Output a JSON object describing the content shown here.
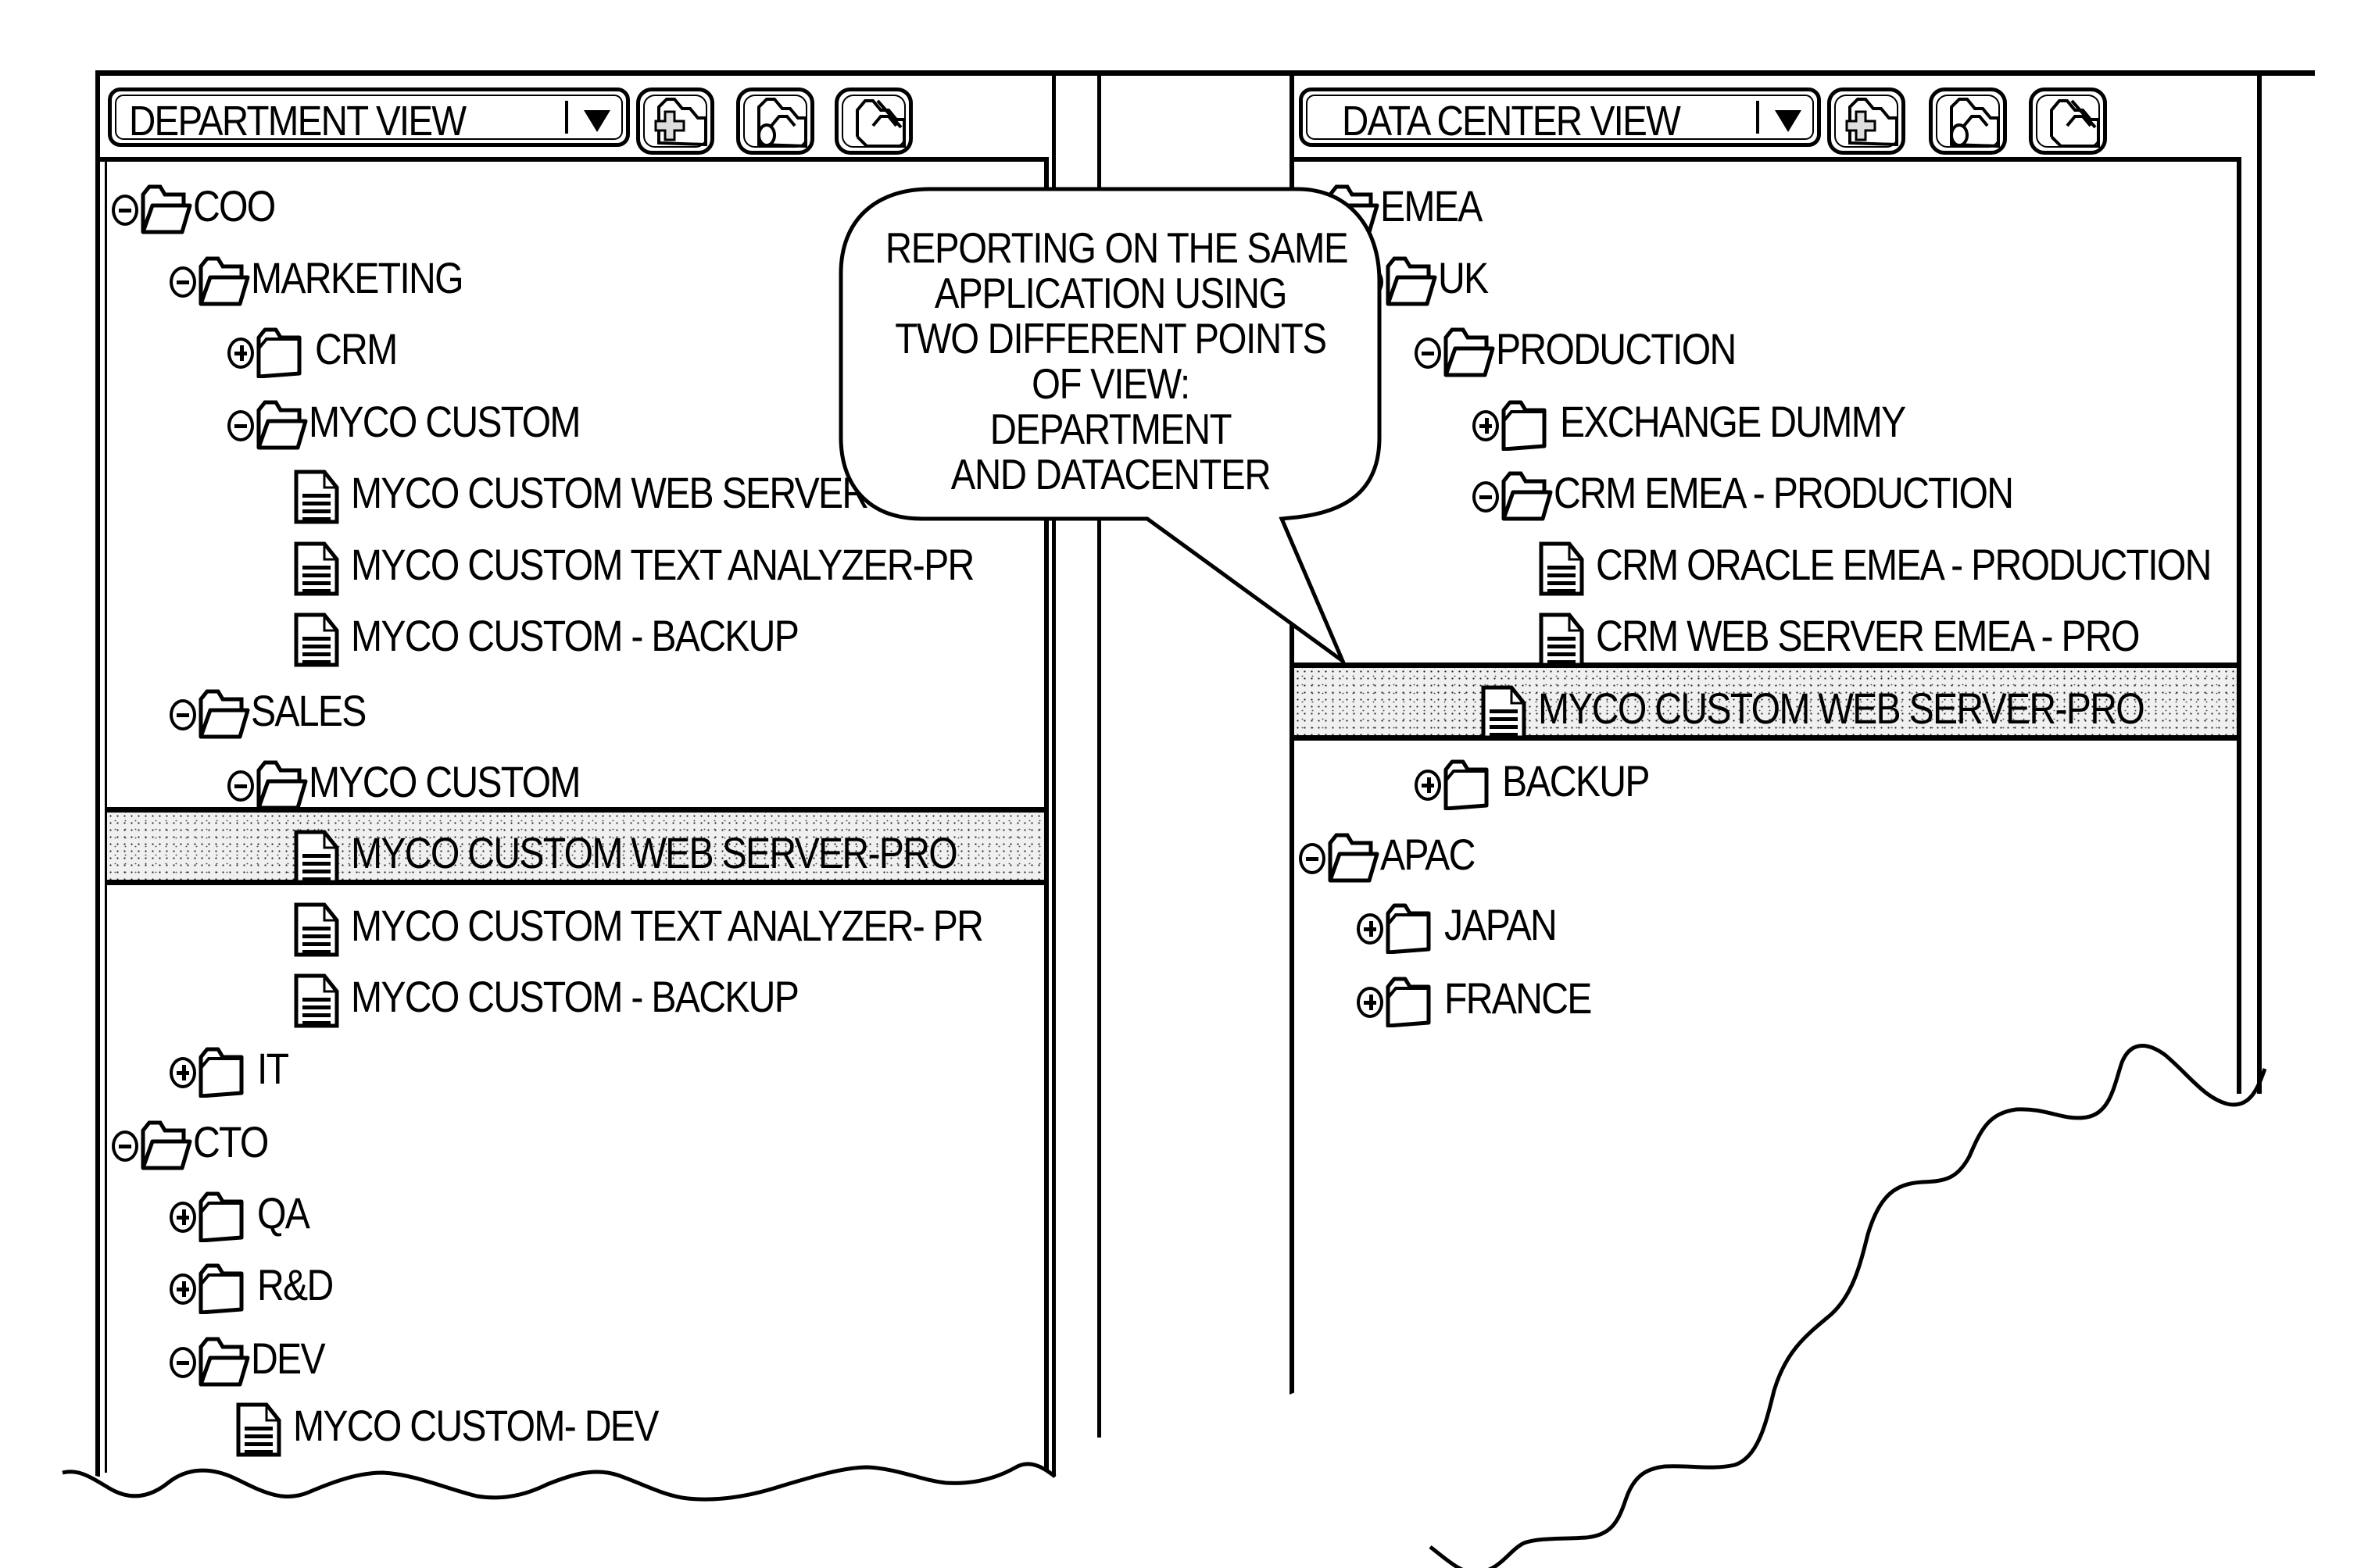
{
  "left_panel": {
    "view_select": {
      "label": "DEPARTMENT VIEW",
      "icon": "dropdown-arrow-icon"
    },
    "toolbar_buttons": [
      {
        "name": "add-folder-button",
        "icon": "folder-add-icon"
      },
      {
        "name": "folder-group-button",
        "icon": "folder-group-icon"
      },
      {
        "name": "folder-remove-button",
        "icon": "folder-remove-icon"
      }
    ],
    "tree": [
      {
        "label": "COO",
        "type": "folder",
        "state": "expanded",
        "level": 0
      },
      {
        "label": "MARKETING",
        "type": "folder",
        "state": "expanded",
        "level": 1
      },
      {
        "label": "CRM",
        "type": "folder",
        "state": "collapsed",
        "level": 2
      },
      {
        "label": "MYCO CUSTOM",
        "type": "folder",
        "state": "expanded",
        "level": 2
      },
      {
        "label": "MYCO CUSTOM WEB SERVER-PRO",
        "type": "document",
        "level": 3
      },
      {
        "label": "MYCO CUSTOM TEXT ANALYZER-PR",
        "type": "document",
        "level": 3
      },
      {
        "label": "MYCO CUSTOM - BACKUP",
        "type": "document",
        "level": 3
      },
      {
        "label": "SALES",
        "type": "folder",
        "state": "expanded",
        "level": 1
      },
      {
        "label": "MYCO CUSTOM",
        "type": "folder",
        "state": "expanded",
        "level": 2
      },
      {
        "label": "MYCO CUSTOM WEB SERVER-PRO",
        "type": "document",
        "level": 3,
        "selected": true
      },
      {
        "label": "MYCO CUSTOM TEXT ANALYZER- PR",
        "type": "document",
        "level": 3
      },
      {
        "label": "MYCO CUSTOM - BACKUP",
        "type": "document",
        "level": 3
      },
      {
        "label": "IT",
        "type": "folder",
        "state": "collapsed",
        "level": 1
      },
      {
        "label": "CTO",
        "type": "folder",
        "state": "expanded",
        "level": 0
      },
      {
        "label": "QA",
        "type": "folder",
        "state": "collapsed",
        "level": 1
      },
      {
        "label": "R&D",
        "type": "folder",
        "state": "collapsed",
        "level": 1
      },
      {
        "label": "DEV",
        "type": "folder",
        "state": "expanded",
        "level": 1
      },
      {
        "label": "MYCO CUSTOM- DEV",
        "type": "document",
        "level": 2
      }
    ]
  },
  "right_panel": {
    "view_select": {
      "label": "DATA CENTER VIEW",
      "icon": "dropdown-arrow-icon"
    },
    "toolbar_buttons": [
      {
        "name": "add-folder-button",
        "icon": "folder-add-icon"
      },
      {
        "name": "folder-group-button",
        "icon": "folder-group-icon"
      },
      {
        "name": "folder-remove-button",
        "icon": "folder-remove-icon"
      }
    ],
    "tree": [
      {
        "label": "EMEA",
        "type": "folder",
        "state": "expanded",
        "level": 0
      },
      {
        "label": "UK",
        "type": "folder",
        "state": "expanded",
        "level": 1
      },
      {
        "label": "PRODUCTION",
        "type": "folder",
        "state": "expanded",
        "level": 2
      },
      {
        "label": "EXCHANGE DUMMY",
        "type": "folder",
        "state": "collapsed",
        "level": 3
      },
      {
        "label": "CRM EMEA - PRODUCTION",
        "type": "folder",
        "state": "expanded",
        "level": 3
      },
      {
        "label": "CRM ORACLE EMEA - PRODUCTION",
        "type": "document",
        "level": 4
      },
      {
        "label": "CRM WEB SERVER EMEA - PRO",
        "type": "document",
        "level": 4
      },
      {
        "label": "MYCO CUSTOM WEB SERVER-PRO",
        "type": "document",
        "level": 3,
        "selected": true
      },
      {
        "label": "BACKUP",
        "type": "folder",
        "state": "collapsed",
        "level": 2
      },
      {
        "label": "APAC",
        "type": "folder",
        "state": "expanded",
        "level": 0
      },
      {
        "label": "JAPAN",
        "type": "folder",
        "state": "collapsed",
        "level": 1
      },
      {
        "label": "FRANCE",
        "type": "folder",
        "state": "collapsed",
        "level": 1
      }
    ]
  },
  "callout": {
    "lines": [
      "REPORTING ON THE SAME",
      "APPLICATION USING",
      "TWO DIFFERENT POINTS",
      "OF VIEW:",
      "DEPARTMENT",
      "AND DATACENTER"
    ]
  }
}
